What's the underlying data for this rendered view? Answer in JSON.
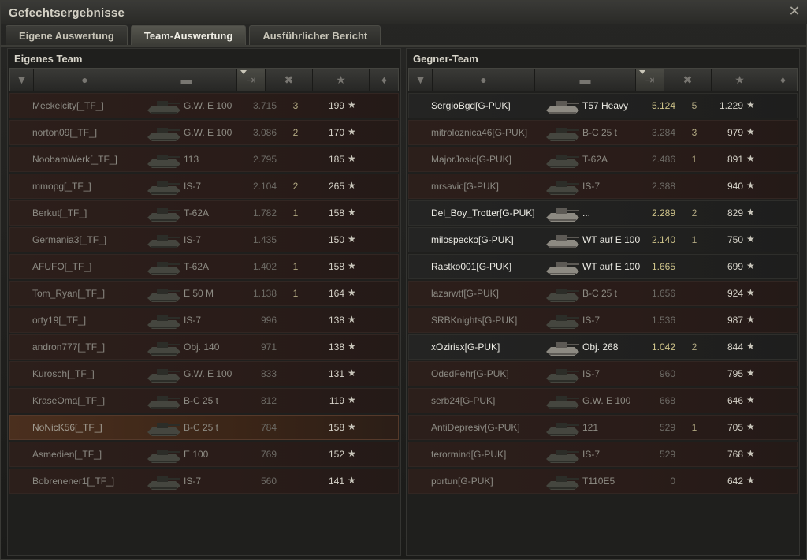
{
  "window": {
    "title": "Gefechtsergebnisse",
    "close_icon": "close-icon"
  },
  "tabs": [
    {
      "label": "Eigene Auswertung",
      "active": false
    },
    {
      "label": "Team-Auswertung",
      "active": true
    },
    {
      "label": "Ausführlicher Bericht",
      "active": false
    }
  ],
  "header_icons": [
    "squad-icon",
    "player-icon",
    "tank-icon",
    "damage-icon",
    "kills-icon",
    "xp-star-icon",
    "medal-icon"
  ],
  "own_team": {
    "title": "Eigenes Team",
    "rows": [
      {
        "name": "Meckelcity[_TF_]",
        "vehicle": "G.W. E 100",
        "damage": "3.715",
        "kills": "3",
        "xp": "199"
      },
      {
        "name": "norton09[_TF_]",
        "vehicle": "G.W. E 100",
        "damage": "3.086",
        "kills": "2",
        "xp": "170"
      },
      {
        "name": "NoobamWerk[_TF_]",
        "vehicle": "113",
        "damage": "2.795",
        "kills": "",
        "xp": "185"
      },
      {
        "name": "mmopg[_TF_]",
        "vehicle": "IS-7",
        "damage": "2.104",
        "kills": "2",
        "xp": "265"
      },
      {
        "name": "Berkut[_TF_]",
        "vehicle": "T-62A",
        "damage": "1.782",
        "kills": "1",
        "xp": "158"
      },
      {
        "name": "Germania3[_TF_]",
        "vehicle": "IS-7",
        "damage": "1.435",
        "kills": "",
        "xp": "150"
      },
      {
        "name": "AFUFO[_TF_]",
        "vehicle": "T-62A",
        "damage": "1.402",
        "kills": "1",
        "xp": "158"
      },
      {
        "name": "Tom_Ryan[_TF_]",
        "vehicle": "E 50 M",
        "damage": "1.138",
        "kills": "1",
        "xp": "164"
      },
      {
        "name": "orty19[_TF_]",
        "vehicle": "IS-7",
        "damage": "996",
        "kills": "",
        "xp": "138"
      },
      {
        "name": "andron777[_TF_]",
        "vehicle": "Obj. 140",
        "damage": "971",
        "kills": "",
        "xp": "138"
      },
      {
        "name": "Kurosch[_TF_]",
        "vehicle": "G.W. E 100",
        "damage": "833",
        "kills": "",
        "xp": "131"
      },
      {
        "name": "KraseOma[_TF_]",
        "vehicle": "B-C 25 t",
        "damage": "812",
        "kills": "",
        "xp": "119"
      },
      {
        "name": "NoNicK56[_TF_]",
        "vehicle": "B-C 25 t",
        "damage": "784",
        "kills": "",
        "xp": "158"
      },
      {
        "name": "Asmedien[_TF_]",
        "vehicle": "E 100",
        "damage": "769",
        "kills": "",
        "xp": "152"
      },
      {
        "name": "Bobrenener1[_TF_]",
        "vehicle": "IS-7",
        "damage": "560",
        "kills": "",
        "xp": "141"
      }
    ]
  },
  "enemy_team": {
    "title": "Gegner-Team",
    "rows": [
      {
        "name": "SergioBgd[G-PUK]",
        "vehicle": "T57 Heavy",
        "damage": "5.124",
        "kills": "5",
        "xp": "1.229"
      },
      {
        "name": "mitroloznica46[G-PUK]",
        "vehicle": "B-C 25 t",
        "damage": "3.284",
        "kills": "3",
        "xp": "979"
      },
      {
        "name": "MajorJosic[G-PUK]",
        "vehicle": "T-62A",
        "damage": "2.486",
        "kills": "1",
        "xp": "891"
      },
      {
        "name": "mrsavic[G-PUK]",
        "vehicle": "IS-7",
        "damage": "2.388",
        "kills": "",
        "xp": "940"
      },
      {
        "name": "Del_Boy_Trotter[G-PUK]",
        "vehicle": "...",
        "damage": "2.289",
        "kills": "2",
        "xp": "829"
      },
      {
        "name": "milospecko[G-PUK]",
        "vehicle": "WT auf E 100",
        "damage": "2.140",
        "kills": "1",
        "xp": "750"
      },
      {
        "name": "Rastko001[G-PUK]",
        "vehicle": "WT auf E 100",
        "damage": "1.665",
        "kills": "",
        "xp": "699"
      },
      {
        "name": "lazarwtf[G-PUK]",
        "vehicle": "B-C 25 t",
        "damage": "1.656",
        "kills": "",
        "xp": "924"
      },
      {
        "name": "SRBKnights[G-PUK]",
        "vehicle": "IS-7",
        "damage": "1.536",
        "kills": "",
        "xp": "987"
      },
      {
        "name": "xOzirisx[G-PUK]",
        "vehicle": "Obj. 268",
        "damage": "1.042",
        "kills": "2",
        "xp": "844"
      },
      {
        "name": "OdedFehr[G-PUK]",
        "vehicle": "IS-7",
        "damage": "960",
        "kills": "",
        "xp": "795"
      },
      {
        "name": "serb24[G-PUK]",
        "vehicle": "G.W. E 100",
        "damage": "668",
        "kills": "",
        "xp": "646"
      },
      {
        "name": "AntiDepresiv[G-PUK]",
        "vehicle": "121",
        "damage": "529",
        "kills": "1",
        "xp": "705"
      },
      {
        "name": "terormind[G-PUK]",
        "vehicle": "IS-7",
        "damage": "529",
        "kills": "",
        "xp": "768"
      },
      {
        "name": "portun[G-PUK]",
        "vehicle": "T110E5",
        "damage": "0",
        "kills": "",
        "xp": "642"
      }
    ]
  },
  "highlight_rows": {
    "own_self_index": 12,
    "enemy_lead_indices": [
      0,
      4,
      5,
      6,
      9
    ]
  },
  "colors": {
    "accent": "#cfc48a",
    "row_red": "#2c1f1b",
    "row_self": "#4a2f1e"
  }
}
